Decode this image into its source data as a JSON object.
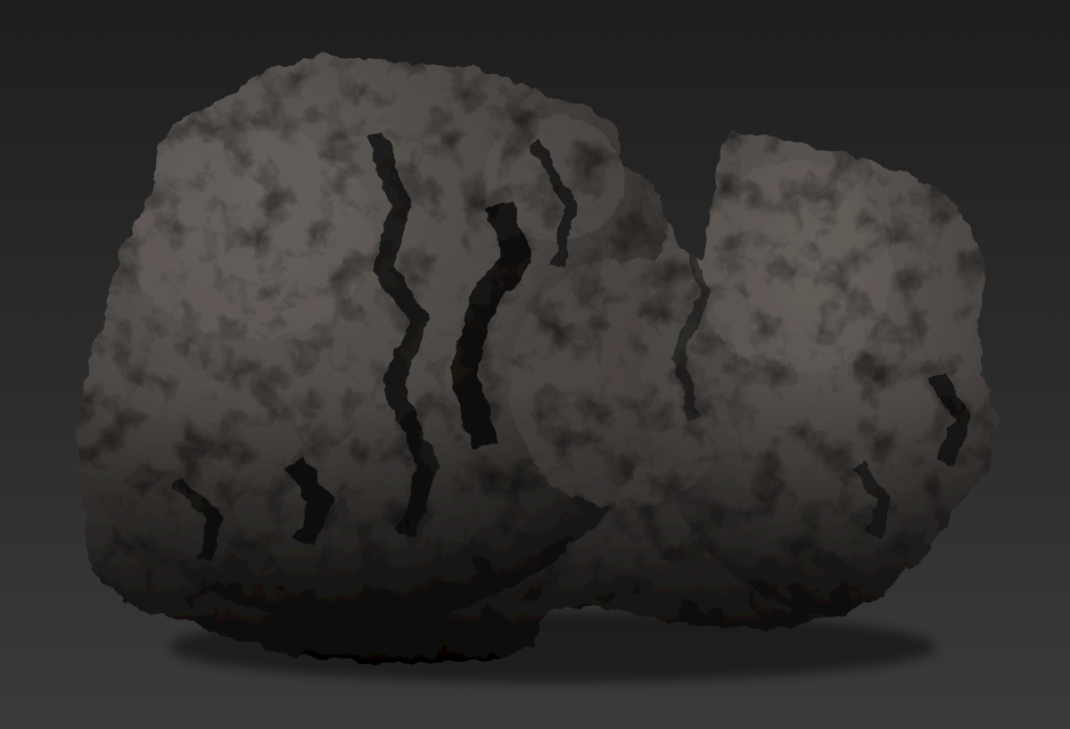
{
  "scene": {
    "object": "rock-model",
    "colors": {
      "background_top": "#1e1e1e",
      "background_bottom": "#3a3a3a",
      "rock_light": "#5e5955",
      "rock_mid": "#4a4643",
      "rock_dark": "#2a2826",
      "shadow": "#050505"
    }
  }
}
